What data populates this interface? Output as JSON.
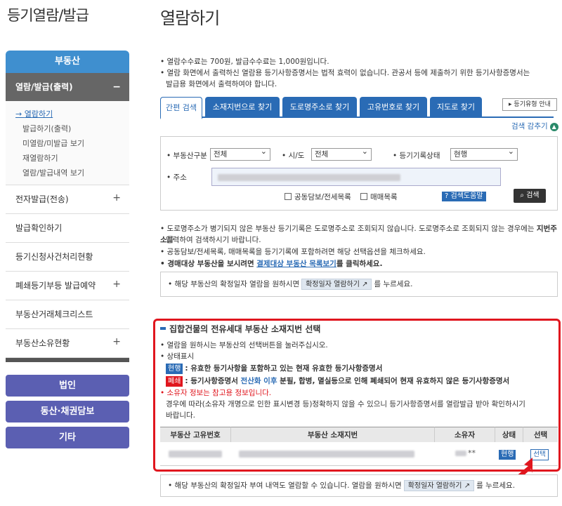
{
  "sidebar": {
    "title": "등기열람/발급",
    "header": "부동산",
    "active_menu": "열람/발급(출력)",
    "active_toggle": "−",
    "submenu": [
      "열람하기",
      "발급하기(출력)",
      "미열람/미발급 보기",
      "재열람하기",
      "열람/발급내역 보기"
    ],
    "items": [
      {
        "label": "전자발급(전송)",
        "toggle": "+"
      },
      {
        "label": "발급확인하기",
        "toggle": ""
      },
      {
        "label": "등기신청사건처리현황",
        "toggle": ""
      },
      {
        "label": "폐쇄등기부등 발급예약",
        "toggle": "+"
      },
      {
        "label": "부동산거래체크리스트",
        "toggle": ""
      },
      {
        "label": "부동산소유현황",
        "toggle": "+"
      }
    ],
    "buttons": [
      "법인",
      "동산·채권담보",
      "기타"
    ]
  },
  "main": {
    "title": "열람하기",
    "notice": [
      "열람수수료는 700원, 발급수수료는 1,000원입니다.",
      "열람 화면에서 출력하신 열람용 등기사항증명서는 법적 효력이 없습니다. 관공서 등에 제출하기 위한 등기사항증명서는",
      "발급용 화면에서 출력하여야 합니다."
    ],
    "tabs": [
      "간편 검색",
      "소재지번으로 찾기",
      "도로명주소로 찾기",
      "고유번호로 찾기",
      "지도로 찾기"
    ],
    "guide_button": "등기유형 안내",
    "hide_search": "검색 감추기",
    "search": {
      "type_label": "• 부동산구분",
      "type_value": "전체",
      "city_label": "• 시/도",
      "city_value": "전체",
      "status_label": "• 등기기록상태",
      "status_value": "현행",
      "address_label": "• 주소",
      "check_joint": "공동담보/전세목록",
      "check_sale": "매매목록",
      "help_button": "검색도움말",
      "search_button": "검색"
    },
    "info": {
      "line1": "도로명주소가 병기되지 않은 부동산 등기기록은 도로명주소로 조회되지 않습니다. 도로명주소로 조회되지 않는 경우에는 ",
      "line1_bold": "지번주소",
      "line1_end": "를",
      "line2": "입력하여 검색하시기 바랍니다.",
      "line3": "공동담보/전세목록, 매매목록을 등기기록에 포함하려면 해당 선택옵션을 체크하세요.",
      "line4_a": "경매대상 부동산을 보시려면 ",
      "line4_link": "결제대상 부동산 목록보기",
      "line4_b": "를 클릭하세요."
    },
    "note1_a": "해당 부동산의 확정일자 열람을 원하시면",
    "note1_pill": "확정일자 열람하기",
    "note1_b": "를 누르세요.",
    "section": {
      "title": "집합건물의 전유세대 부동산 소재지번 선택",
      "line1": "열람을 원하시는 부동산의 선택버튼을 눌러주십시오.",
      "line2": "상태표시",
      "badge_cur": "현행",
      "badge_cur_text": ": 유효한 등기사항을 포함하고 있는 현재 유효한 등기사항증명서",
      "badge_closed": "폐쇄",
      "badge_closed_a": ": 등기사항증명서 ",
      "badge_closed_blue": "전산화 이후",
      "badge_closed_b": " 분필, 합병, 멸실등으로 인해 폐쇄되어 현재 유효하지 않은 등기사항증명서",
      "warn": "소유자 정보는 참고용 정보입니다.",
      "warn2": "경우에 따라(소유자 개명으로 인한 표시변경 등)정확하지 않을 수 있으니 등기사항증명서를 열람발급 받아 확인하시기",
      "warn3": "바랍니다.",
      "columns": [
        "부동산 고유번호",
        "부동산 소재지번",
        "소유자",
        "상태",
        "선택"
      ],
      "row": {
        "owner": "**",
        "state": "현행",
        "select": "선택"
      }
    },
    "note2_a": "해당 부동산의 확정일자 부여 내역도 열람할 수 있습니다. 열람을 원하시면",
    "note2_pill": "확정일자 열람하기",
    "note2_b": "를 누르세요."
  }
}
